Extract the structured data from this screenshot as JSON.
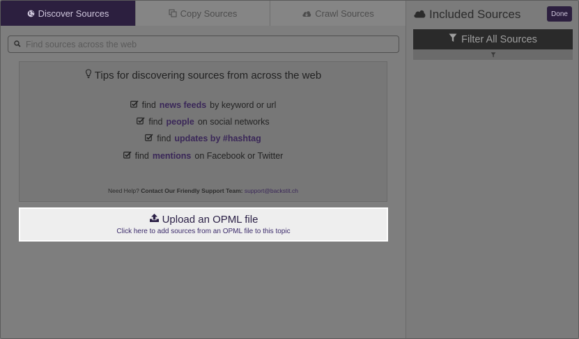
{
  "tabs": [
    {
      "label": "Discover Sources",
      "icon": "globe-icon",
      "active": true
    },
    {
      "label": "Copy Sources",
      "icon": "copy-icon",
      "active": false
    },
    {
      "label": "Crawl Sources",
      "icon": "cloud-download-icon",
      "active": false
    }
  ],
  "search": {
    "placeholder": "Find sources across the web"
  },
  "tips": {
    "title": "Tips for discovering sources from across the web",
    "items": [
      {
        "pre": "find",
        "highlight": "news feeds",
        "post": "by keyword or url"
      },
      {
        "pre": "find",
        "highlight": "people",
        "post": "on social networks"
      },
      {
        "pre": "find",
        "highlight": "updates by #hashtag",
        "post": ""
      },
      {
        "pre": "find",
        "highlight": "mentions",
        "post": "on Facebook or Twitter"
      }
    ],
    "help_prefix": "Need Help?",
    "help_bold": "Contact Our Friendly Support Team:",
    "help_email": "support@backstit.ch"
  },
  "upload": {
    "title": "Upload an OPML file",
    "subtitle": "Click here to add sources from an OPML file to this topic"
  },
  "included": {
    "title": "Included Sources",
    "done_label": "Done",
    "filter_label": "Filter All Sources"
  },
  "colors": {
    "accent": "#2c1f3f",
    "link": "#3a2758"
  }
}
